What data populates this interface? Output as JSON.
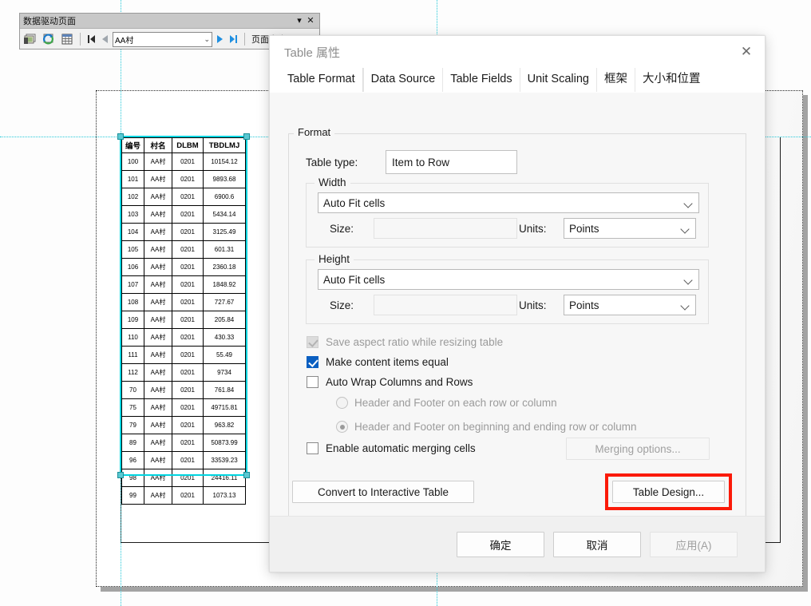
{
  "toolbar": {
    "title": "数据驱动页面",
    "caret_icon": "chevron-down-icon",
    "close_icon": "close-icon",
    "icons": [
      "page-layers-icon",
      "refresh-pages-icon",
      "page-table-icon"
    ],
    "nav_first_label": "|◀",
    "nav_prev_label": "◀",
    "nav_next_label": "▶",
    "nav_last_label": "▶|",
    "combo_value": "AA村",
    "page_text_label": "页面文本(P) ▾"
  },
  "dialog": {
    "title": "Table 属性",
    "close_icon": "close-icon",
    "tabs": [
      {
        "label": "Table Format",
        "active": true
      },
      {
        "label": "Data Source",
        "active": false
      },
      {
        "label": "Table Fields",
        "active": false
      },
      {
        "label": "Unit Scaling",
        "active": false
      },
      {
        "label": "框架",
        "active": false
      },
      {
        "label": "大小和位置",
        "active": false
      }
    ],
    "format": {
      "legend": "Format",
      "table_type_label": "Table type:",
      "table_type_value": "Item to Row",
      "width": {
        "legend": "Width",
        "mode_value": "Auto Fit cells",
        "size_label": "Size:",
        "size_value": "",
        "units_label": "Units:",
        "units_value": "Points"
      },
      "height": {
        "legend": "Height",
        "mode_value": "Auto Fit cells",
        "size_label": "Size:",
        "size_value": "",
        "units_label": "Units:",
        "units_value": "Points"
      },
      "checkboxes": [
        {
          "label": "Save aspect ratio while resizing table",
          "checked": true,
          "disabled": true
        },
        {
          "label": "Make content items equal",
          "checked": true,
          "disabled": false
        },
        {
          "label": "Auto Wrap Columns and Rows",
          "checked": false,
          "disabled": false
        }
      ],
      "radios": [
        {
          "label": "Header and Footer on each row or column",
          "selected": false
        },
        {
          "label": "Header and Footer on beginning and ending row or column",
          "selected": true
        }
      ],
      "merging_checkbox": {
        "label": "Enable automatic merging cells",
        "checked": false
      },
      "merging_button": "Merging options...",
      "convert_button": "Convert to Interactive Table",
      "design_button": "Table Design..."
    },
    "footer": {
      "ok": "确定",
      "cancel": "取消",
      "apply": "应用(A)"
    }
  },
  "highlight_color": "#fb1a08",
  "selection_color": "#00d5e0",
  "attribute_table": {
    "columns": [
      "编号",
      "村名",
      "DLBM",
      "TBDLMJ"
    ],
    "rows": [
      [
        "100",
        "AA村",
        "0201",
        "10154.12"
      ],
      [
        "101",
        "AA村",
        "0201",
        "9893.68"
      ],
      [
        "102",
        "AA村",
        "0201",
        "6900.6"
      ],
      [
        "103",
        "AA村",
        "0201",
        "5434.14"
      ],
      [
        "104",
        "AA村",
        "0201",
        "3125.49"
      ],
      [
        "105",
        "AA村",
        "0201",
        "601.31"
      ],
      [
        "106",
        "AA村",
        "0201",
        "2360.18"
      ],
      [
        "107",
        "AA村",
        "0201",
        "1848.92"
      ],
      [
        "108",
        "AA村",
        "0201",
        "727.67"
      ],
      [
        "109",
        "AA村",
        "0201",
        "205.84"
      ],
      [
        "110",
        "AA村",
        "0201",
        "430.33"
      ],
      [
        "111",
        "AA村",
        "0201",
        "55.49"
      ],
      [
        "112",
        "AA村",
        "0201",
        "9734"
      ],
      [
        "70",
        "AA村",
        "0201",
        "761.84"
      ],
      [
        "75",
        "AA村",
        "0201",
        "49715.81"
      ],
      [
        "79",
        "AA村",
        "0201",
        "963.82"
      ],
      [
        "89",
        "AA村",
        "0201",
        "50873.99"
      ],
      [
        "96",
        "AA村",
        "0201",
        "33539.23"
      ],
      [
        "98",
        "AA村",
        "0201",
        "24416.11"
      ],
      [
        "99",
        "AA村",
        "0201",
        "1073.13"
      ]
    ]
  }
}
